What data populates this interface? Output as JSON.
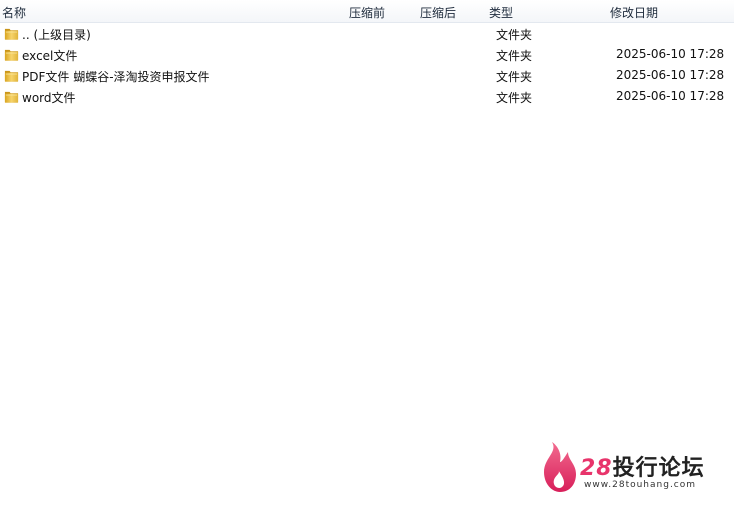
{
  "columns": {
    "name": "名称",
    "before": "压缩前",
    "after": "压缩后",
    "type": "类型",
    "modified": "修改日期"
  },
  "rows": [
    {
      "name": ".. (上级目录)",
      "type": "文件夹",
      "modified": "",
      "icon": "folder-icon"
    },
    {
      "name": "excel文件",
      "type": "文件夹",
      "modified": "2025-06-10 17:28",
      "icon": "folder-icon"
    },
    {
      "name": "PDF文件 蝴蝶谷-泽淘投资申报文件",
      "type": "文件夹",
      "modified": "2025-06-10 17:28",
      "icon": "folder-icon"
    },
    {
      "name": "word文件",
      "type": "文件夹",
      "modified": "2025-06-10 17:28",
      "icon": "folder-icon"
    }
  ],
  "watermark": {
    "number": "28",
    "title": "投行论坛",
    "url": "www.28touhang.com",
    "brand_color": "#e8346b"
  }
}
